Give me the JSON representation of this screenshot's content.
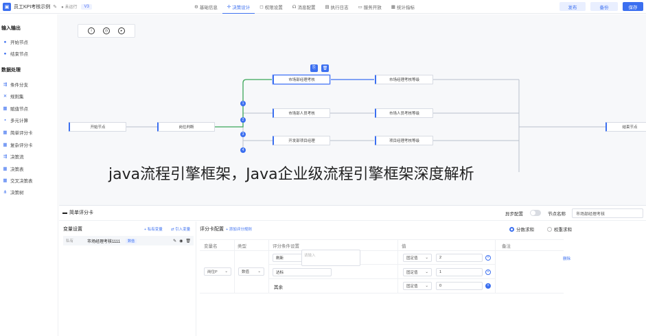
{
  "header": {
    "logo_glyph": "▣",
    "app_title": "员工KPI考核示例",
    "status": "● 未运行",
    "version": "V3",
    "tabs": [
      {
        "icon": "⚙",
        "label": "基础信息"
      },
      {
        "icon": "✢",
        "label": "决策设计"
      },
      {
        "icon": "◻",
        "label": "权限设置"
      },
      {
        "icon": "☊",
        "label": "消息配置"
      },
      {
        "icon": "▤",
        "label": "执行日志"
      },
      {
        "icon": "▭",
        "label": "服务开放"
      },
      {
        "icon": "▦",
        "label": "统计指标"
      }
    ],
    "publish": "发布",
    "backup": "备份",
    "save": "保存"
  },
  "sidebar": {
    "groups": [
      {
        "title": "输入输出",
        "items": [
          {
            "icon": "●",
            "label": "开始节点"
          },
          {
            "icon": "●",
            "label": "结束节点"
          }
        ]
      },
      {
        "title": "数据处理",
        "items": [
          {
            "icon": "⇶",
            "label": "条件分支"
          },
          {
            "icon": "✕",
            "label": "规则集"
          },
          {
            "icon": "▦",
            "label": "赋值节点"
          },
          {
            "icon": "▪",
            "label": "多元计算"
          },
          {
            "icon": "▦",
            "label": "简单评分卡"
          },
          {
            "icon": "▦",
            "label": "复杂评分卡"
          },
          {
            "icon": "⇶",
            "label": "决策流"
          },
          {
            "icon": "▦",
            "label": "决策表"
          },
          {
            "icon": "▦",
            "label": "交叉决策表"
          },
          {
            "icon": "⋔",
            "label": "决策树"
          }
        ]
      }
    ]
  },
  "canvas": {
    "tools": [
      "i",
      "◷",
      "▸"
    ],
    "nodes": {
      "start": "开始节点",
      "position": "岗位判断",
      "mgr": "市场部经理考核",
      "mgr_grade": "市场经理考核等级",
      "staff": "市场部人员考核",
      "staff_grade": "市场人员考核等级",
      "dev": "开发部项目经理",
      "dev_grade": "项目经理考核等级",
      "end": "结束节点"
    },
    "branch_numbers": [
      "1",
      "2",
      "3",
      "4"
    ],
    "float_buttons": [
      "⎘",
      "🗑"
    ]
  },
  "overlay_caption": "java流程引擎框架，Java企业级流程引擎框架深度解析",
  "panel": {
    "tab_label": "简单评分卡",
    "async_label": "异步配置",
    "node_name_label": "节点名称",
    "node_name_value": "市场部经理考核",
    "variables": {
      "title": "变量设置",
      "add_private": "+ 私有变量",
      "import": "⇄ 引入变量",
      "row": {
        "scope": "私有",
        "name": "市场经理考核1111",
        "type": "数值"
      }
    },
    "score": {
      "title": "评分卡配置",
      "add_rule": "+ 添加评分规则",
      "mode_sum": "分数求和",
      "mode_weight": "权重求和",
      "headers": {
        "var": "变量名",
        "type": "类型",
        "cond": "评分条件设置",
        "value": "值",
        "remark": "备注"
      },
      "var_select": "岗位P",
      "type_select": "数值",
      "rows": [
        {
          "cond": "刷新",
          "value_type": "固定值",
          "value": "2",
          "btn": "+"
        },
        {
          "cond": "达标",
          "value_type": "固定值",
          "value": "1",
          "btn": "+"
        },
        {
          "cond": "其余",
          "value_type": "固定值",
          "value": "0",
          "btn": "+"
        }
      ],
      "remark_placeholder": "请输入",
      "delete": "删除"
    }
  }
}
